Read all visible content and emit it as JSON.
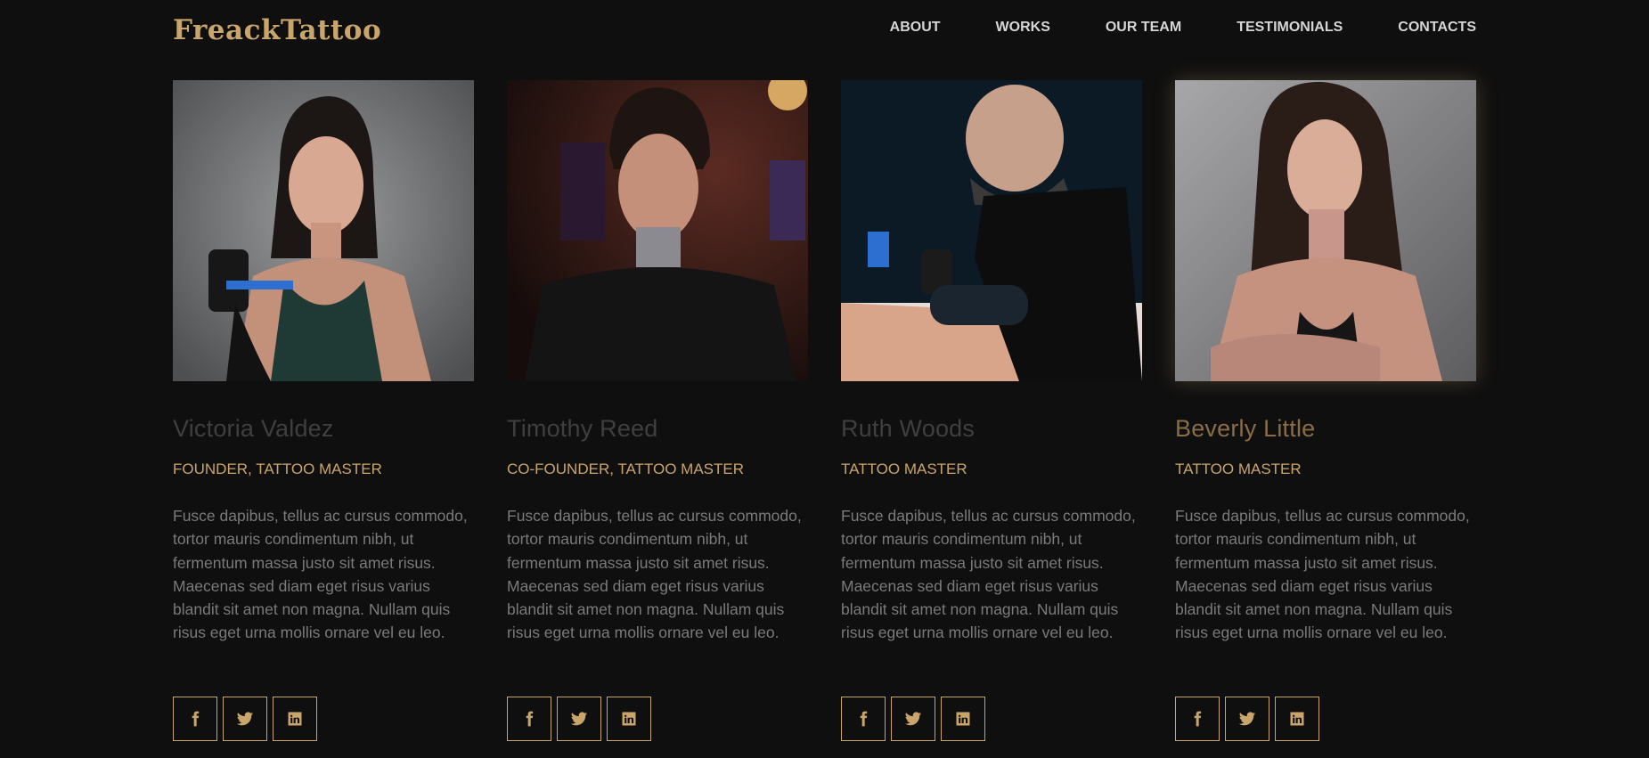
{
  "brand": {
    "logo": "FreackTattoo",
    "accent_color": "#c9a56b",
    "background": "#0f0f0f"
  },
  "nav": {
    "items": [
      {
        "label": "ABOUT"
      },
      {
        "label": "WORKS"
      },
      {
        "label": "OUR TEAM"
      },
      {
        "label": "TESTIMONIALS"
      },
      {
        "label": "CONTACTS"
      }
    ]
  },
  "team": [
    {
      "name": "Victoria Valdez",
      "role": "FOUNDER, TATTOO MASTER",
      "bio": "Fusce dapibus, tellus ac cursus commodo, tortor mauris condimentum nibh, ut fermentum massa justo sit amet risus. Maecenas sed diam eget risus varius blandit sit amet non magna. Nullam quis risus eget urna mollis ornare vel eu leo.",
      "photo": "woman-with-tattoo-machine-photo",
      "socials": [
        "facebook-icon",
        "twitter-icon",
        "linkedin-icon"
      ]
    },
    {
      "name": "Timothy Reed",
      "role": "CO-FOUNDER, TATTOO MASTER",
      "bio": "Fusce dapibus, tellus ac cursus commodo, tortor mauris condimentum nibh, ut fermentum massa justo sit amet risus. Maecenas sed diam eget risus varius blandit sit amet non magna. Nullam quis risus eget urna mollis ornare vel eu leo.",
      "photo": "man-with-neck-tattoo-photo",
      "socials": [
        "facebook-icon",
        "twitter-icon",
        "linkedin-icon"
      ]
    },
    {
      "name": "Ruth Woods",
      "role": "TATTOO MASTER",
      "bio": "Fusce dapibus, tellus ac cursus commodo, tortor mauris condimentum nibh, ut fermentum massa justo sit amet risus. Maecenas sed diam eget risus varius blandit sit amet non magna. Nullam quis risus eget urna mollis ornare vel eu leo.",
      "photo": "tattoo-artist-working-photo",
      "socials": [
        "facebook-icon",
        "twitter-icon",
        "linkedin-icon"
      ]
    },
    {
      "name": "Beverly Little",
      "role": "TATTOO MASTER",
      "bio": "Fusce dapibus, tellus ac cursus commodo, tortor mauris condimentum nibh, ut fermentum massa justo sit amet risus. Maecenas sed diam eget risus varius blandit sit amet non magna. Nullam quis risus eget urna mollis ornare vel eu leo.",
      "photo": "tattooed-woman-portrait-photo",
      "socials": [
        "facebook-icon",
        "twitter-icon",
        "linkedin-icon"
      ]
    }
  ]
}
